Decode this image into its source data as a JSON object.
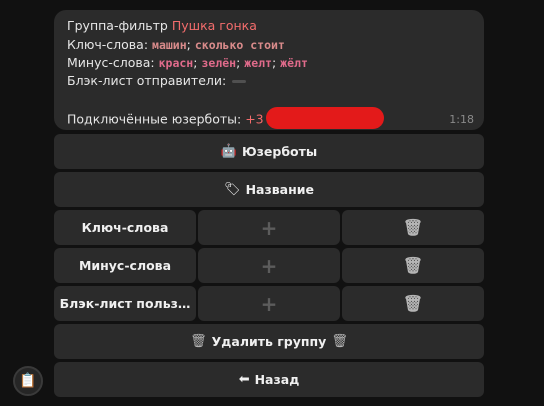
{
  "message": {
    "group_label": "Группа-фильтр",
    "group_name": "Пушка гонка",
    "keywords_label": "Ключ-слова:",
    "keywords": [
      "машин",
      "сколько стоит"
    ],
    "minus_label": "Минус-слова:",
    "minus_words": [
      "красн",
      "зелён",
      "желт",
      "жёлт"
    ],
    "blacklist_label": "Блэк-лист отправители:",
    "userbots_label": "Подключённые юзерботы:",
    "userbots_value": "+3",
    "time": "1:18",
    "separator": ";"
  },
  "buttons": {
    "userbots": {
      "icon": "🤖",
      "label": "Юзерботы"
    },
    "name": {
      "icon": "🏷",
      "label": "Название"
    },
    "keywords": {
      "label": "Ключ-слова",
      "add": "+",
      "delete": "🗑"
    },
    "minus": {
      "label": "Минус-слова",
      "add": "+",
      "delete": "🗑"
    },
    "blacklist": {
      "label": "Блэк-лист польз…",
      "add": "+",
      "delete": "🗑"
    },
    "delete_group": {
      "icon": "🗑",
      "label": "Удалить группу"
    },
    "back": {
      "icon": "⬅",
      "label": "Назад"
    }
  },
  "avatar": {
    "icon": "📋"
  }
}
